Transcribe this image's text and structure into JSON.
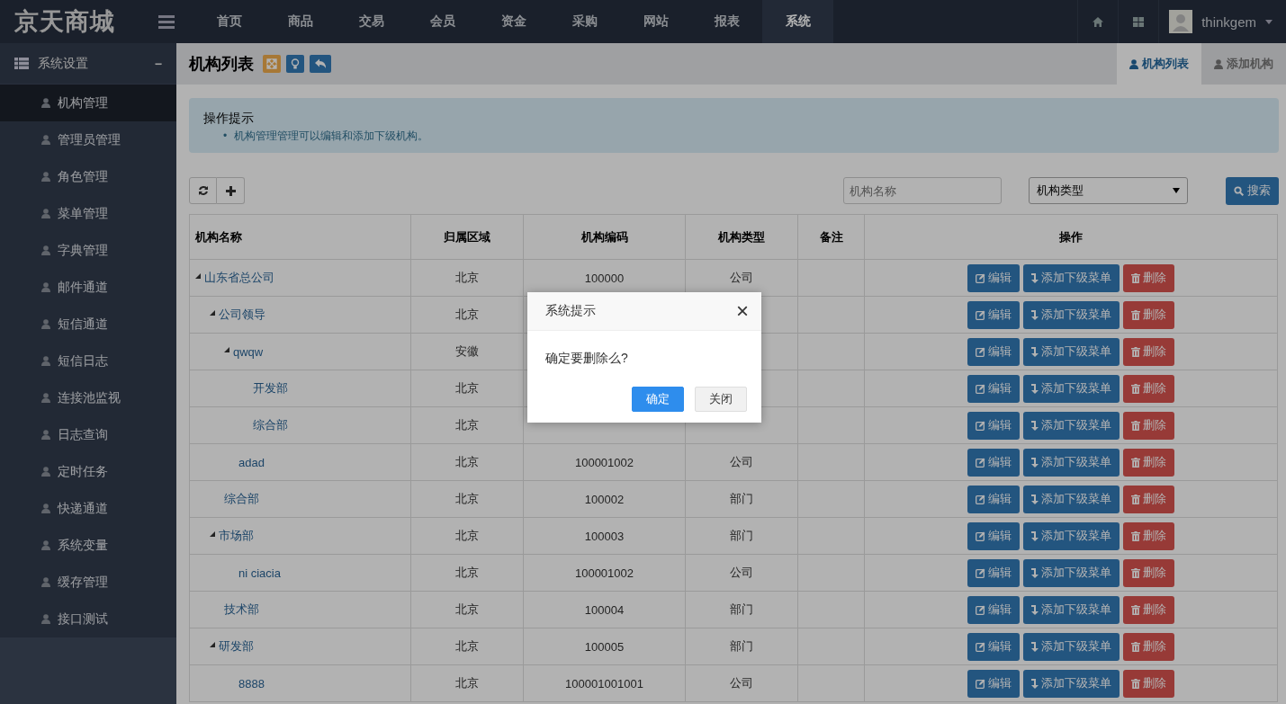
{
  "brand": "京天商城",
  "nav": [
    {
      "label": "首页",
      "selected": false
    },
    {
      "label": "商品",
      "selected": false
    },
    {
      "label": "交易",
      "selected": false
    },
    {
      "label": "会员",
      "selected": false
    },
    {
      "label": "资金",
      "selected": false
    },
    {
      "label": "采购",
      "selected": false
    },
    {
      "label": "网站",
      "selected": false
    },
    {
      "label": "报表",
      "selected": false
    },
    {
      "label": "系统",
      "selected": true
    }
  ],
  "user": {
    "name": "thinkgem"
  },
  "sidebar": {
    "title": "系统设置",
    "toggle": "−",
    "items": [
      {
        "label": "机构管理",
        "selected": true
      },
      {
        "label": "管理员管理",
        "selected": false
      },
      {
        "label": "角色管理",
        "selected": false
      },
      {
        "label": "菜单管理",
        "selected": false
      },
      {
        "label": "字典管理",
        "selected": false
      },
      {
        "label": "邮件通道",
        "selected": false
      },
      {
        "label": "短信通道",
        "selected": false
      },
      {
        "label": "短信日志",
        "selected": false
      },
      {
        "label": "连接池监视",
        "selected": false
      },
      {
        "label": "日志查询",
        "selected": false
      },
      {
        "label": "定时任务",
        "selected": false
      },
      {
        "label": "快递通道",
        "selected": false
      },
      {
        "label": "系统变量",
        "selected": false
      },
      {
        "label": "缓存管理",
        "selected": false
      },
      {
        "label": "接口测试",
        "selected": false
      }
    ]
  },
  "page": {
    "title": "机构列表",
    "tabs": [
      {
        "label": "机构列表",
        "selected": true
      },
      {
        "label": "添加机构",
        "selected": false
      }
    ]
  },
  "alert": {
    "title": "操作提示",
    "items": [
      {
        "bullet": "•",
        "text": "机构管理管理可以编辑和添加下级机构。"
      }
    ]
  },
  "filters": {
    "name_placeholder": "机构名称",
    "type_value": "机构类型",
    "search": "搜索"
  },
  "table": {
    "columns": [
      "机构名称",
      "归属区域",
      "机构编码",
      "机构类型",
      "备注",
      "操作"
    ],
    "rows": [
      {
        "name": "山东省总公司",
        "region": "北京",
        "code": "100000",
        "type": "公司",
        "actions": [
          "编辑",
          "添加下级菜单",
          "删除"
        ],
        "expanded": true,
        "children": [
          {
            "name": "公司领导",
            "region": "北京",
            "actions": [
              "编辑",
              "添加下级菜单",
              "删除"
            ],
            "expanded": true,
            "children": [
              {
                "name": "qwqw",
                "region": "安徽",
                "actions": [
                  "编辑",
                  "添加下级菜单",
                  "删除"
                ],
                "expanded": true,
                "children": [
                  {
                    "name": "开发部",
                    "region": "北京",
                    "actions": [
                      "编辑",
                      "添加下级菜单",
                      "删除"
                    ]
                  },
                  {
                    "name": "综合部",
                    "region": "北京",
                    "actions": [
                      "编辑",
                      "添加下级菜单",
                      "删除"
                    ]
                  }
                ]
              },
              {
                "name": "adad",
                "region": "北京",
                "code": "100001002",
                "type": "公司",
                "actions": [
                  "编辑",
                  "添加下级菜单",
                  "删除"
                ]
              }
            ]
          },
          {
            "name": "综合部",
            "region": "北京",
            "code": "100002",
            "type": "部门",
            "actions": [
              "编辑",
              "添加下级菜单",
              "删除"
            ]
          },
          {
            "name": "市场部",
            "region": "北京",
            "code": "100003",
            "type": "部门",
            "actions": [
              "编辑",
              "添加下级菜单",
              "删除"
            ],
            "expanded": true,
            "children": [
              {
                "name": "ni ciacia",
                "region": "北京",
                "code": "100001002",
                "type": "公司",
                "actions": [
                  "编辑",
                  "添加下级菜单",
                  "删除"
                ]
              }
            ]
          },
          {
            "name": "技术部",
            "region": "北京",
            "code": "100004",
            "type": "部门",
            "actions": [
              "编辑",
              "添加下级菜单",
              "删除"
            ]
          },
          {
            "name": "研发部",
            "region": "北京",
            "code": "100005",
            "type": "部门",
            "actions": [
              "编辑",
              "添加下级菜单",
              "删除"
            ],
            "expanded": true,
            "children": [
              {
                "name": "8888",
                "region": "北京",
                "code": "100001001001",
                "type": "公司",
                "actions": [
                  "编辑",
                  "添加下级菜单",
                  "删除"
                ]
              }
            ]
          }
        ]
      }
    ]
  },
  "dialog": {
    "title": "系统提示",
    "close": "×",
    "message": "确定要删除么?",
    "buttons": [
      {
        "label": "确定",
        "kind": "primary"
      },
      {
        "label": "关闭",
        "kind": "default"
      }
    ]
  }
}
